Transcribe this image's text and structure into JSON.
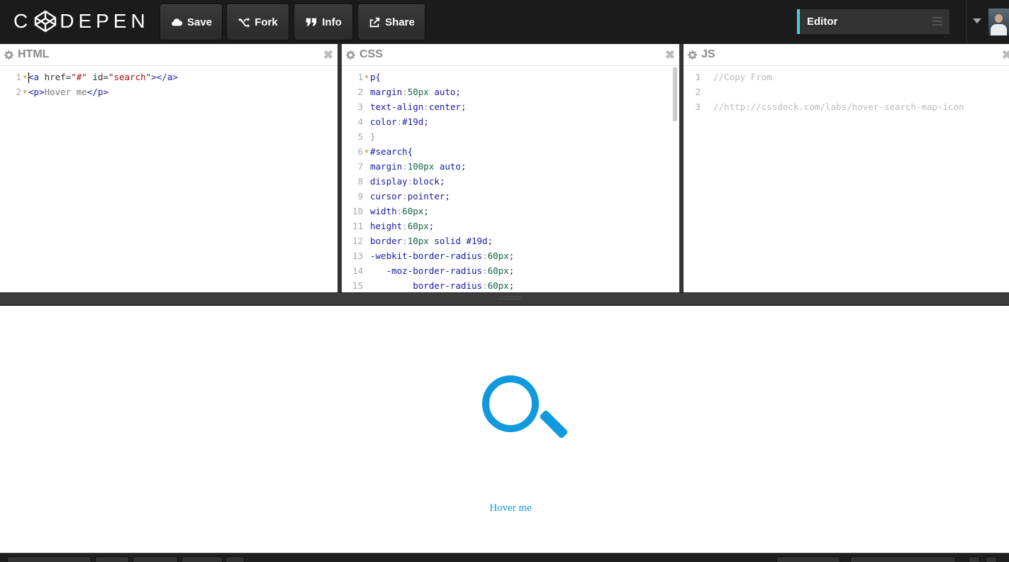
{
  "header": {
    "logo_text_pre": "C",
    "logo_text_post": "DEPEN",
    "buttons": [
      {
        "label": "Save",
        "icon": "cloud-icon"
      },
      {
        "label": "Fork",
        "icon": "fork-icon"
      },
      {
        "label": "Info",
        "icon": "quote-icon"
      },
      {
        "label": "Share",
        "icon": "share-icon"
      }
    ],
    "view_select": "Editor"
  },
  "panes": {
    "html": {
      "title": "HTML",
      "lines": [
        [
          "1",
          "<a href=\"#\" id=\"search\"></a>"
        ],
        [
          "2",
          "<p>Hover me</p>"
        ]
      ]
    },
    "css": {
      "title": "CSS",
      "lines": [
        [
          "1",
          "p{"
        ],
        [
          "2",
          "margin:50px auto;"
        ],
        [
          "3",
          "text-align:center;"
        ],
        [
          "4",
          "color:#19d;"
        ],
        [
          "5",
          "}"
        ],
        [
          "6",
          "#search{"
        ],
        [
          "7",
          "margin:100px auto;"
        ],
        [
          "8",
          "display:block;"
        ],
        [
          "9",
          "cursor:pointer;"
        ],
        [
          "10",
          "width:60px;"
        ],
        [
          "11",
          "height:60px;"
        ],
        [
          "12",
          "border:10px solid #19d;"
        ],
        [
          "13",
          "-webkit-border-radius:60px;"
        ],
        [
          "14",
          "   -moz-border-radius:60px;"
        ],
        [
          "15",
          "        border-radius:60px;"
        ]
      ]
    },
    "js": {
      "title": "JS",
      "lines": [
        [
          "1",
          "//Copy From"
        ],
        [
          "2",
          ""
        ],
        [
          "3",
          "//http://cssdeck.com/labs/hover-search-map-icon"
        ]
      ]
    }
  },
  "preview": {
    "text": "Hover me",
    "accent": "#1199dd"
  },
  "colors": {
    "header_bg": "#1b1b1b",
    "editor_accent": "#47cfe0"
  }
}
